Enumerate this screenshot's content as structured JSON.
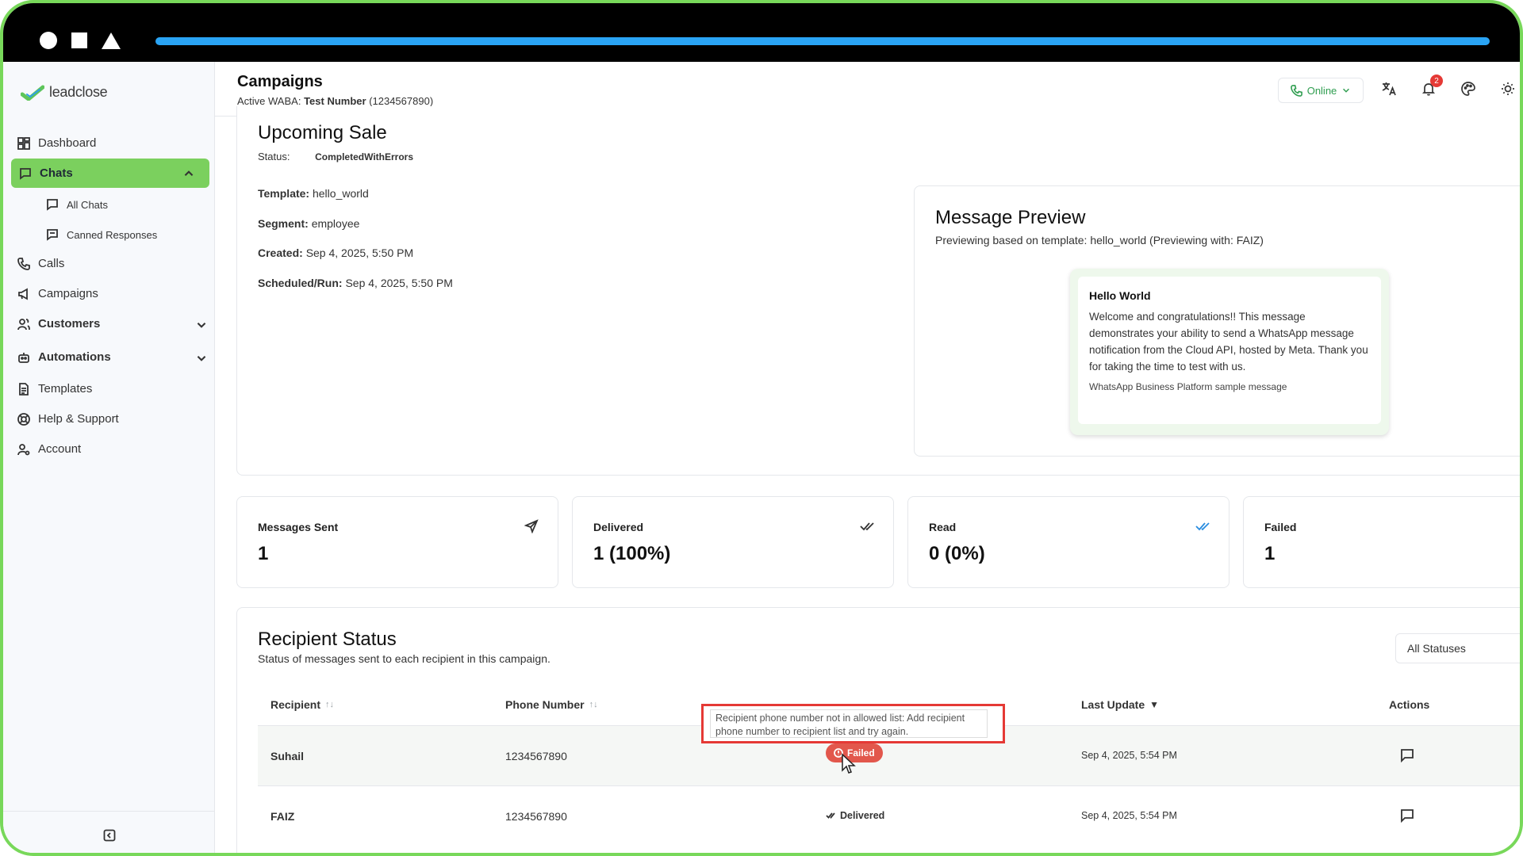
{
  "sidebar": {
    "logo_text": "leadclose",
    "items": {
      "dashboard": "Dashboard",
      "chats": "Chats",
      "all_chats": "All Chats",
      "canned": "Canned Responses",
      "calls": "Calls",
      "campaigns": "Campaigns",
      "customers": "Customers",
      "automations": "Automations",
      "templates": "Templates",
      "help": "Help & Support",
      "account": "Account"
    }
  },
  "header": {
    "title": "Campaigns",
    "waba_prefix": "Active WABA:",
    "waba_name": "Test Number",
    "waba_number": "(1234567890)",
    "online_label": "Online",
    "notification_count": "2"
  },
  "campaign": {
    "name": "Upcoming Sale",
    "status_label": "Status:",
    "status_value": "CompletedWithErrors",
    "template_label": "Template:",
    "template_value": "hello_world",
    "segment_label": "Segment:",
    "segment_value": "employee",
    "created_label": "Created:",
    "created_value": "Sep 4, 2025, 5:50 PM",
    "scheduled_label": "Scheduled/Run:",
    "scheduled_value": "Sep 4, 2025, 5:50 PM"
  },
  "preview": {
    "title": "Message Preview",
    "subtitle": "Previewing based on template: hello_world (Previewing with: FAIZ)",
    "msg_title": "Hello World",
    "msg_body": "Welcome and congratulations!! This message demonstrates your ability to send a WhatsApp message notification from the Cloud API, hosted by Meta. Thank you for taking the time to test with us.",
    "msg_footer": "WhatsApp Business Platform sample message"
  },
  "stats": {
    "sent_label": "Messages Sent",
    "sent_value": "1",
    "delivered_label": "Delivered",
    "delivered_value": "1 (100%)",
    "read_label": "Read",
    "read_value": "0 (0%)",
    "failed_label": "Failed",
    "failed_value": "1"
  },
  "recipients": {
    "title": "Recipient Status",
    "subtitle": "Status of messages sent to each recipient in this campaign.",
    "filter_value": "All Statuses",
    "columns": {
      "recipient": "Recipient",
      "phone": "Phone Number",
      "last_update": "Last Update",
      "actions": "Actions"
    },
    "rows": [
      {
        "name": "Suhail",
        "phone": "1234567890",
        "status": "Failed",
        "updated": "Sep 4, 2025, 5:54 PM"
      },
      {
        "name": "FAIZ",
        "phone": "1234567890",
        "status": "Delivered",
        "updated": "Sep 4, 2025, 5:54 PM"
      }
    ],
    "tooltip": "Recipient phone number not in allowed list: Add recipient phone number to recipient list and try again."
  },
  "colors": {
    "accent": "#7bd05e",
    "failed": "#e2574c",
    "online": "#2e9d4f",
    "frame": "#78d85a"
  }
}
